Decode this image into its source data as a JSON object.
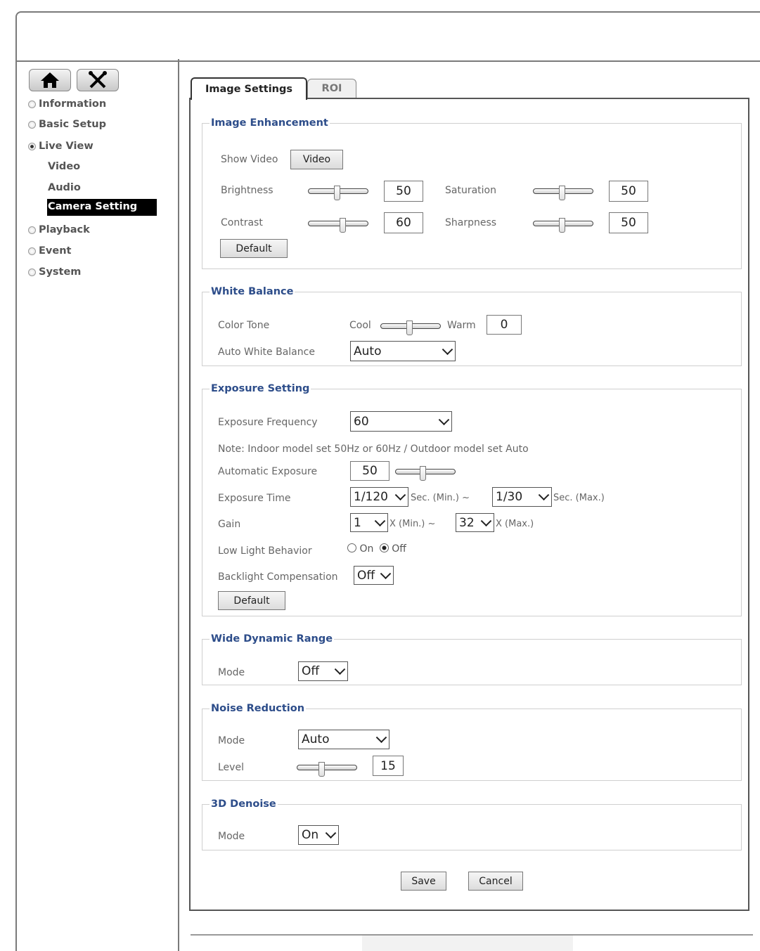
{
  "sidebar": {
    "nav": [
      {
        "label": "Information",
        "selected": false
      },
      {
        "label": "Basic Setup",
        "selected": false
      },
      {
        "label": "Live View",
        "selected": true
      },
      {
        "label": "Playback",
        "selected": false
      },
      {
        "label": "Event",
        "selected": false
      },
      {
        "label": "System",
        "selected": false
      }
    ],
    "live_view_sub": [
      "Video",
      "Audio",
      "Camera Setting"
    ],
    "active_sub": "Camera Setting"
  },
  "tabs": [
    "Image Settings",
    "ROI"
  ],
  "image_enhancement": {
    "legend": "Image Enhancement",
    "show_video_label": "Show Video",
    "video_button": "Video",
    "brightness_label": "Brightness",
    "brightness": "50",
    "contrast_label": "Contrast",
    "contrast": "60",
    "saturation_label": "Saturation",
    "saturation": "50",
    "sharpness_label": "Sharpness",
    "sharpness": "50",
    "default_button": "Default"
  },
  "white_balance": {
    "legend": "White Balance",
    "color_tone_label": "Color Tone",
    "cool_label": "Cool",
    "warm_label": "Warm",
    "color_tone": "0",
    "awb_label": "Auto White Balance",
    "awb_value": "Auto"
  },
  "exposure": {
    "legend": "Exposure Setting",
    "frequency_label": "Exposure Frequency",
    "frequency_value": "60",
    "note": "Note: Indoor model set 50Hz or 60Hz / Outdoor model set Auto",
    "auto_exposure_label": "Automatic Exposure",
    "auto_exposure_value": "50",
    "time_label": "Exposure Time",
    "time_min": "1/120",
    "sec_min_label": "Sec.  (Min.) ~",
    "time_max": "1/30",
    "sec_max_label": "Sec.  (Max.)",
    "gain_label": "Gain",
    "gain_min": "1",
    "gain_min_label": "X  (Min.) ~",
    "gain_max": "32",
    "gain_max_label": "X  (Max.)",
    "low_light_label": "Low Light Behavior",
    "on_label": "On",
    "off_label": "Off",
    "backlight_label": "Backlight Compensation",
    "backlight_value": "Off",
    "default_button": "Default"
  },
  "wdr": {
    "legend": "Wide Dynamic Range",
    "mode_label": "Mode",
    "mode_value": "Off"
  },
  "noise_reduction": {
    "legend": "Noise Reduction",
    "mode_label": "Mode",
    "mode_value": "Auto",
    "level_label": "Level",
    "level_value": "15"
  },
  "denoise_3d": {
    "legend": "3D Denoise",
    "mode_label": "Mode",
    "mode_value": "On"
  },
  "actions": {
    "save": "Save",
    "cancel": "Cancel"
  }
}
